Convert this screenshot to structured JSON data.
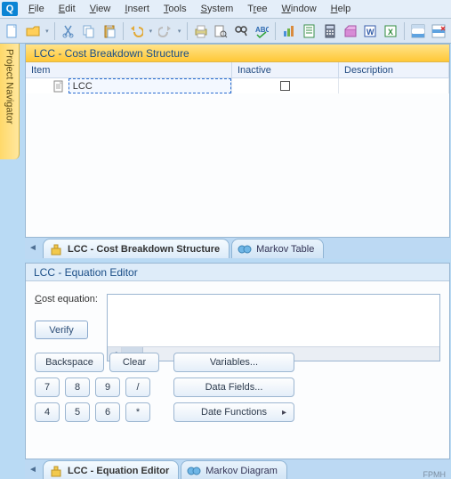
{
  "menus": {
    "file": "File",
    "edit": "Edit",
    "view": "View",
    "insert": "Insert",
    "tools": "Tools",
    "system": "System",
    "tree": "Tree",
    "window": "Window",
    "help": "Help"
  },
  "sidebar": {
    "label": "Project Navigator"
  },
  "top_panel": {
    "title": "LCC - Cost Breakdown Structure",
    "columns": {
      "item": "Item",
      "inactive": "Inactive",
      "description": "Description"
    },
    "row": {
      "value": "LCC",
      "inactive": false
    }
  },
  "top_tabs": {
    "active": "LCC - Cost Breakdown Structure",
    "other": "Markov Table"
  },
  "bottom_panel": {
    "title": "LCC - Equation Editor",
    "cost_label": "Cost equation:",
    "verify": "Verify"
  },
  "keypad": {
    "backspace": "Backspace",
    "clear": "Clear",
    "keys_row1": [
      "7",
      "8",
      "9",
      "/"
    ],
    "keys_row2": [
      "4",
      "5",
      "6",
      "*"
    ]
  },
  "func_buttons": {
    "variables": "Variables...",
    "data_fields": "Data Fields...",
    "date_functions": "Date Functions"
  },
  "bottom_tabs": {
    "active": "LCC - Equation Editor",
    "other": "Markov Diagram"
  },
  "status": "FPMH"
}
